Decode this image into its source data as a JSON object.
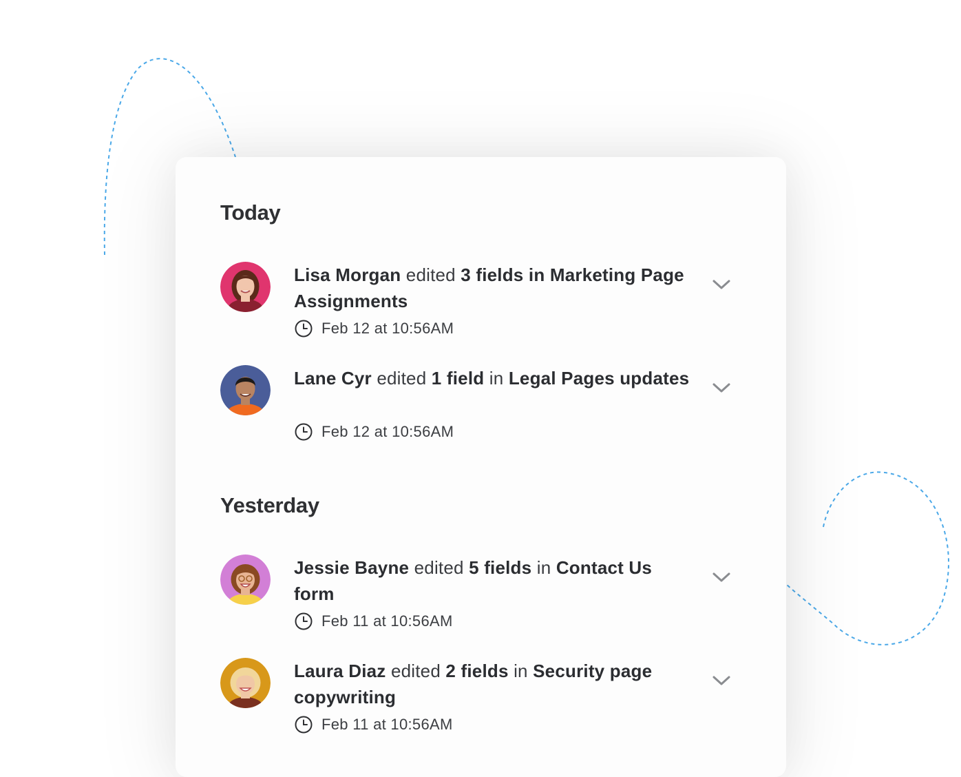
{
  "sections": [
    {
      "title": "Today",
      "entries": [
        {
          "user": "Lisa Morgan",
          "verb": "edited",
          "count_text": "3 fields",
          "prep": "in",
          "target": "Marketing Page Assignments",
          "timestamp": "Feb 12 at 10:56AM",
          "avatar_color": "#e0356e",
          "skin": "#f1c6ad",
          "hair": "#5a2a1a",
          "shirt": "#8a2030",
          "count_bold": true,
          "prep_bold": true
        },
        {
          "user": "Lane Cyr",
          "verb": "edited",
          "count_text": "1 field",
          "prep": "in",
          "target": "Legal Pages updates",
          "timestamp": "Feb 12 at 10:56AM",
          "avatar_color": "#4a5d99",
          "skin": "#b98462",
          "hair": "#1e1a18",
          "shirt": "#f06a20",
          "count_bold": true,
          "prep_bold": false
        }
      ]
    },
    {
      "title": "Yesterday",
      "entries": [
        {
          "user": "Jessie Bayne",
          "verb": "edited",
          "count_text": "5 fields",
          "prep": "in",
          "target": "Contact Us form",
          "timestamp": "Feb 11 at 10:56AM",
          "avatar_color": "#d27fd6",
          "skin": "#e8b493",
          "hair": "#8a4a22",
          "shirt": "#f6d04a",
          "count_bold": true,
          "prep_bold": false
        },
        {
          "user": "Laura Diaz",
          "verb": "edited",
          "count_text": "2 fields",
          "prep": "in",
          "target": "Security page copywriting",
          "timestamp": "Feb 11 at 10:56AM",
          "avatar_color": "#d8981a",
          "skin": "#f0c7a6",
          "hair": "#f1d69a",
          "shirt": "#7a3020",
          "count_bold": true,
          "prep_bold": false
        }
      ]
    }
  ],
  "colors": {
    "accent_dashes": "#4aa8e8",
    "chevron": "#8a8c90",
    "card_bg": "#fdfdfd"
  },
  "icons": {
    "timestamp": "clock-icon",
    "expand": "chevron-down-icon"
  }
}
